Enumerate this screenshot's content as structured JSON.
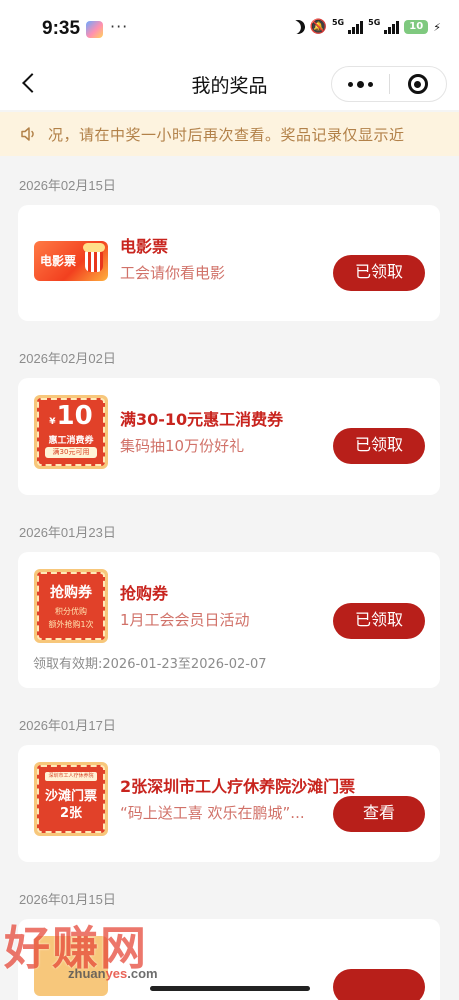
{
  "status_bar": {
    "time": "9:35",
    "more": "···",
    "network_1": "5G",
    "network_2": "5G",
    "battery": "10"
  },
  "nav": {
    "title": "我的奖品"
  },
  "notice": {
    "text": "况，请在中奖一小时后再次查看。奖品记录仅显示近",
    "color": "#b28149"
  },
  "prizes": [
    {
      "date": "2026年02月15日",
      "thumb_text": "电影票",
      "title": "电影票",
      "subtitle": "工会请你看电影",
      "action": "已领取"
    },
    {
      "date": "2026年02月02日",
      "thumb_big": "10",
      "thumb_currency": "¥",
      "thumb_line1": "惠工消费券",
      "thumb_line2": "满30元可用",
      "title": "满30-10元惠工消费券",
      "subtitle": "集码抽10万份好礼",
      "action": "已领取"
    },
    {
      "date": "2026年01月23日",
      "thumb_title": "抢购券",
      "thumb_line1": "积分优购",
      "thumb_line2": "额外抢购1次",
      "title": "抢购券",
      "subtitle": "1月工会会员日活动",
      "validity": "领取有效期:2026-01-23至2026-02-07",
      "action": "已领取"
    },
    {
      "date": "2026年01月17日",
      "thumb_top": "深圳市工人疗休养院",
      "thumb_line1": "沙滩门票",
      "thumb_line2": "2张",
      "title": "2张深圳市工人疗休养院沙滩门票",
      "subtitle": "“码上送工喜 欢乐在鹏城”...",
      "action": "查看"
    },
    {
      "date": "2026年01月15日"
    }
  ],
  "watermark": {
    "text": "好赚网",
    "url_a": "zhuan",
    "url_b": "yes",
    "url_c": ".com"
  },
  "colors": {
    "accent": "#b81f1a",
    "title_red": "#c8241e",
    "subtitle_red": "#d17269",
    "notice_bg": "#fdf3df"
  }
}
